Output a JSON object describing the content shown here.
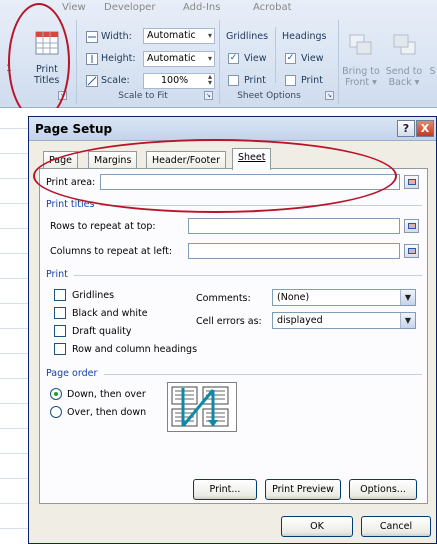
{
  "ribbon": {
    "tabs": [
      "View",
      "Developer",
      "Add-Ins",
      "Acrobat"
    ],
    "print_titles": {
      "line1": "Print",
      "line2": "Titles",
      "icon": "print-titles-icon"
    },
    "scale_group": {
      "width_label": "Width:",
      "width_value": "Automatic",
      "height_label": "Height:",
      "height_value": "Automatic",
      "scale_label": "Scale:",
      "scale_value": "100%",
      "group_label": "Scale to Fit"
    },
    "sheet_options": {
      "gridlines_label": "Gridlines",
      "headings_label": "Headings",
      "view_label": "View",
      "print_label": "Print",
      "gridlines_view_checked": true,
      "gridlines_print_checked": false,
      "headings_view_checked": true,
      "headings_print_checked": false,
      "group_label": "Sheet Options"
    },
    "arrange": {
      "bring_line1": "Bring to",
      "bring_line2": "Front",
      "send_line1": "Send to",
      "send_line2": "Back",
      "extra": "S"
    }
  },
  "dialog": {
    "title": "Page Setup",
    "help_glyph": "?",
    "close_glyph": "X",
    "tabs": [
      "Page",
      "Margins",
      "Header/Footer",
      "Sheet"
    ],
    "active_tab": "Sheet",
    "print_area_label": "Print area:",
    "print_titles_section": "Print titles",
    "rows_label": "Rows to repeat at top:",
    "cols_label": "Columns to repeat at left:",
    "print_section": "Print",
    "checkboxes": [
      "Gridlines",
      "Black and white",
      "Draft quality",
      "Row and column headings"
    ],
    "comments_label": "Comments:",
    "comments_value": "(None)",
    "cell_errors_label": "Cell errors as:",
    "cell_errors_value": "displayed",
    "page_order_section": "Page order",
    "order_down": "Down, then over",
    "order_over": "Over, then down",
    "print_btn": "Print...",
    "preview_btn": "Print Preview",
    "options_btn": "Options...",
    "ok_btn": "OK",
    "cancel_btn": "Cancel"
  },
  "colors": {
    "annotation": "#b8142a",
    "section_text": "#1541a8",
    "title_bar": "#c4d3ea"
  }
}
